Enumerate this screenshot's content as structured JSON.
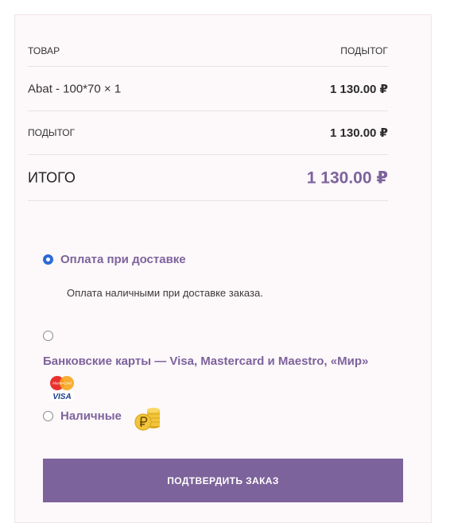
{
  "order_table": {
    "header": {
      "product": "ТОВАР",
      "subtotal": "ПОДЫТОГ"
    },
    "items": [
      {
        "name": "Abat - 100*70  × 1",
        "price": "1 130.00 ₽"
      }
    ],
    "subtotal": {
      "label": "ПОДЫТОГ",
      "value": "1 130.00 ₽"
    },
    "total": {
      "label": "ИТОГО",
      "value": "1 130.00 ₽"
    }
  },
  "payment_methods": [
    {
      "label": "Оплата при доставке",
      "description": "Оплата наличными при доставке заказа.",
      "selected": true,
      "icon": "none"
    },
    {
      "label": "Банковские карты — Visa, Mastercard и Maestro, «Мир»",
      "selected": false,
      "icon": "mastercard-visa-icon",
      "card_brands": {
        "mastercard": "MasterCard",
        "visa": "VISA"
      }
    },
    {
      "label": "Наличные",
      "selected": false,
      "icon": "ruble-coins-icon"
    }
  ],
  "confirm_button": {
    "label": "ПОДТВЕРДИТЬ ЗАКАЗ"
  },
  "colors": {
    "accent": "#7d639c",
    "radio_selected": "#2b6bd6",
    "panel_bg": "#fdf8fa"
  }
}
